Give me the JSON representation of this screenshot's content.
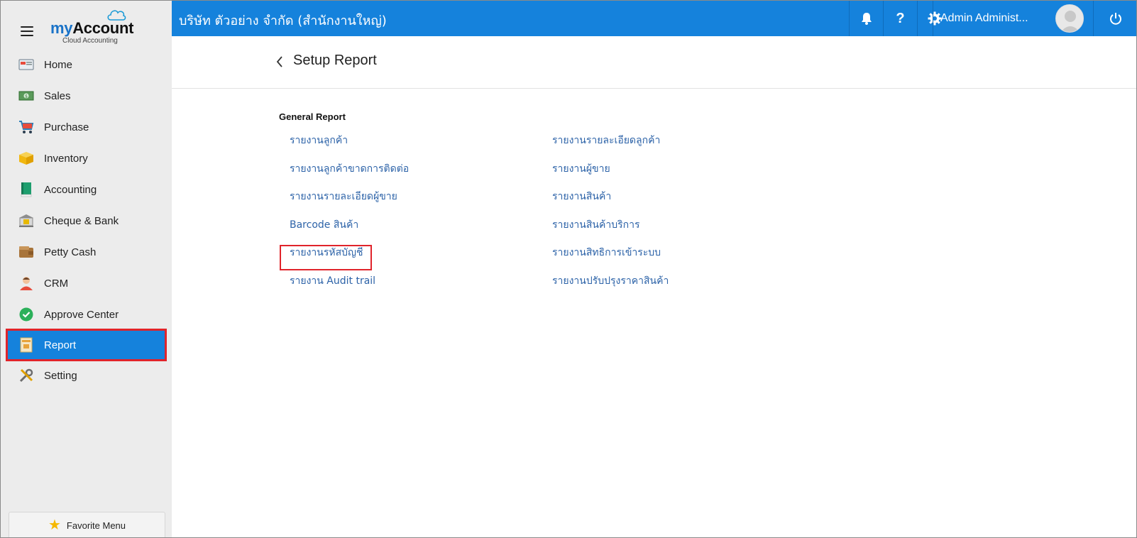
{
  "logo": {
    "title_my": "my",
    "title_account": "Account",
    "subtitle": "Cloud Accounting"
  },
  "sidebar": {
    "items": [
      {
        "label": "Home",
        "icon": "home-icon"
      },
      {
        "label": "Sales",
        "icon": "sales-icon"
      },
      {
        "label": "Purchase",
        "icon": "cart-icon"
      },
      {
        "label": "Inventory",
        "icon": "box-icon"
      },
      {
        "label": "Accounting",
        "icon": "ledger-book-icon"
      },
      {
        "label": "Cheque & Bank",
        "icon": "bank-icon"
      },
      {
        "label": "Petty Cash",
        "icon": "wallet-icon"
      },
      {
        "label": "CRM",
        "icon": "person-icon"
      },
      {
        "label": "Approve Center",
        "icon": "check-circle-icon"
      },
      {
        "label": "Report",
        "icon": "report-icon",
        "active": true
      },
      {
        "label": "Setting",
        "icon": "tools-icon"
      }
    ],
    "favorite_label": "Favorite Menu"
  },
  "topbar": {
    "company": "บริษัท ตัวอย่าง จำกัด (สำนักงานใหญ่)",
    "user_name": "Admin Administ...",
    "help_label": "?"
  },
  "page": {
    "title": "Setup Report",
    "section": "General Report",
    "left_links": [
      "รายงานลูกค้า",
      "รายงานลูกค้าขาดการติดต่อ",
      "รายงานรายละเอียดผู้ขาย",
      "Barcode สินค้า",
      "รายงานรหัสบัญชี",
      "รายงาน Audit trail"
    ],
    "right_links": [
      "รายงานรายละเอียดลูกค้า",
      "รายงานผู้ขาย",
      "รายงานสินค้า",
      "รายงานสินค้าบริการ",
      "รายงานสิทธิการเข้าระบบ",
      "รายงานปรับปรุงราคาสินค้า"
    ]
  },
  "colors": {
    "primary": "#1582dc",
    "highlight": "#e0242b",
    "link": "#2d63a8",
    "sidebar_bg": "#ececec"
  }
}
